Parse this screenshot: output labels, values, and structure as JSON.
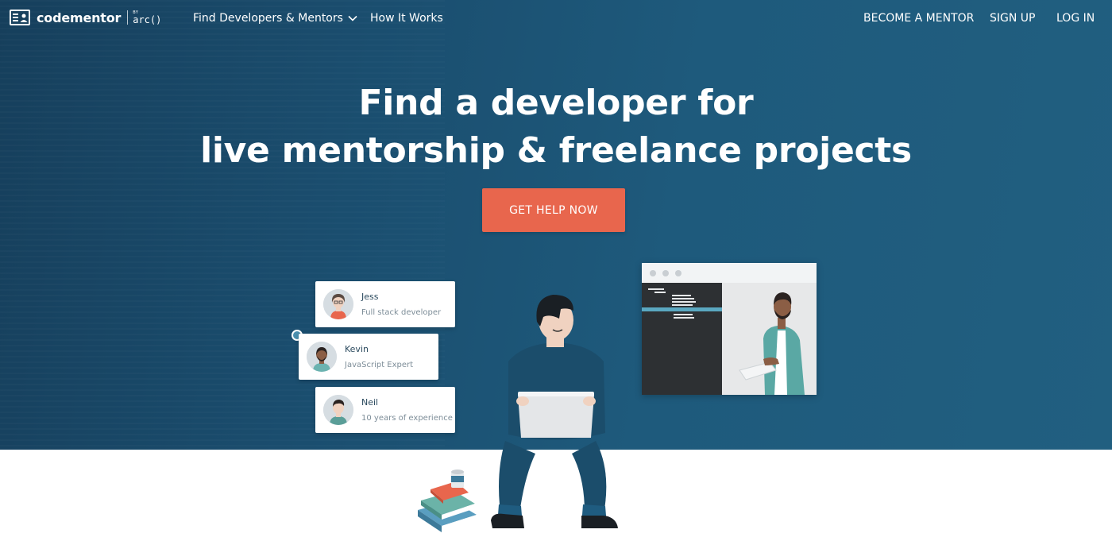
{
  "nav": {
    "logo_text": "codementor",
    "logo_by": "BY",
    "logo_arc": "arc()",
    "find_label": "Find Developers & Mentors",
    "how_label": "How It Works",
    "mentor_label": "BECOME A MENTOR",
    "signup_label": "SIGN UP",
    "login_label": "LOG IN"
  },
  "hero": {
    "line1": "Find a developer for",
    "line2": "live mentorship & freelance projects",
    "cta_label": "GET HELP NOW"
  },
  "cards": [
    {
      "name": "Jess",
      "role": "Full stack developer"
    },
    {
      "name": "Kevin",
      "role": "JavaScript Expert"
    },
    {
      "name": "Neil",
      "role": "10 years of experience"
    }
  ],
  "colors": {
    "cta": "#e8664d",
    "hero_bg": "#1a4d6e",
    "accent": "#4a8fae"
  }
}
